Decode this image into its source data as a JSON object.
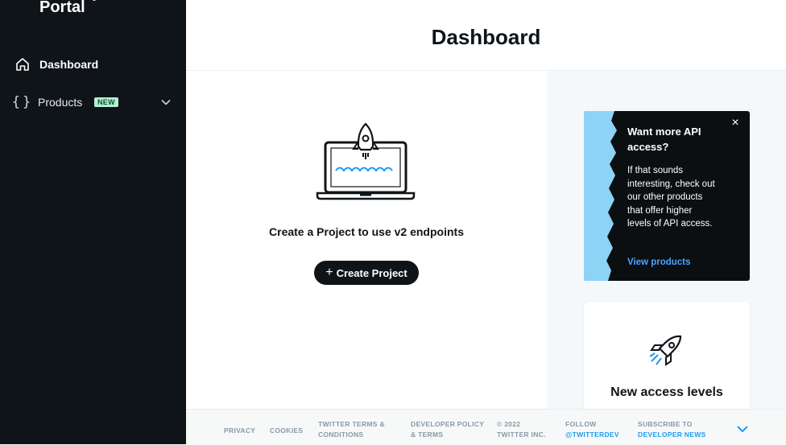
{
  "sidebar": {
    "portal_title": "Portal",
    "items": [
      {
        "label": "Dashboard",
        "icon": "home-icon"
      },
      {
        "label": "Products",
        "icon": "braces-icon",
        "badge": "NEW"
      }
    ],
    "braces_glyph": "{}"
  },
  "header": {
    "title": "Dashboard"
  },
  "main": {
    "cta_text": "Create a Project to use v2 endpoints",
    "create_button": "Create Project",
    "plus_glyph": "+"
  },
  "promo": {
    "title": "Want more API access?",
    "body": "If that sounds interesting, check out our other products that offer higher levels of API access.",
    "link": "View products",
    "close_glyph": "×"
  },
  "access_card": {
    "title": "New access levels"
  },
  "footer": {
    "privacy": "PRIVACY",
    "cookies": "COOKIES",
    "terms_line1": "TWITTER TERMS &",
    "terms_line2": "CONDITIONS",
    "devpolicy_line1": "DEVELOPER POLICY",
    "devpolicy_line2": "& TERMS",
    "copyright_line1": "© 2022",
    "copyright_line2": "TWITTER INC.",
    "follow_line1": "FOLLOW",
    "follow_line2": "@TWITTERDEV",
    "subscribe_line1": "SUBSCRIBE TO",
    "subscribe_line2": "DEVELOPER NEWS"
  },
  "colors": {
    "sidebar_bg": "#0f1419",
    "accent_blue": "#1d9bf0",
    "badge_bg": "#b4f0d1",
    "promo_blue": "#8dd3f5"
  }
}
